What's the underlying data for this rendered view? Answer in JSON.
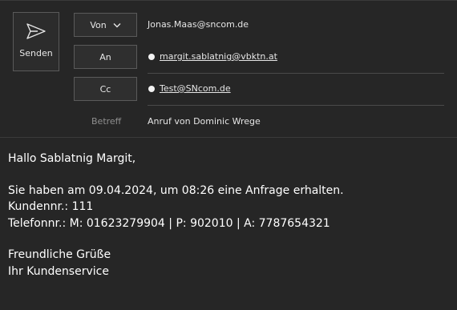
{
  "compose": {
    "send_label": "Senden",
    "from_label": "Von",
    "from_value": "Jonas.Maas@sncom.de",
    "to_label": "An",
    "to_value": "margit.sablatnig@vbktn.at",
    "cc_label": "Cc",
    "cc_value": "Test@SNcom.de",
    "subject_label": "Betreff",
    "subject_value": "Anruf von Dominic Wrege"
  },
  "body": {
    "greeting": "Hallo Sablatnig Margit,",
    "line1": "Sie haben am 09.04.2024, um 08:26 eine Anfrage erhalten.",
    "line2": "Kundennr.: 111",
    "line3": "Telefonnr.: M: 01623279904 | P: 902010 | A: 7787654321",
    "closing1": "Freundliche Grüße",
    "closing2": "Ihr Kundenservice"
  },
  "icons": {
    "send": "send-icon",
    "from_dropdown": "chevron-down-icon",
    "recipient_status": "presence-dot-icon"
  },
  "colors": {
    "background": "#262626",
    "text": "#ffffff",
    "muted": "#8f8f8f",
    "border": "#5a5a5a"
  }
}
